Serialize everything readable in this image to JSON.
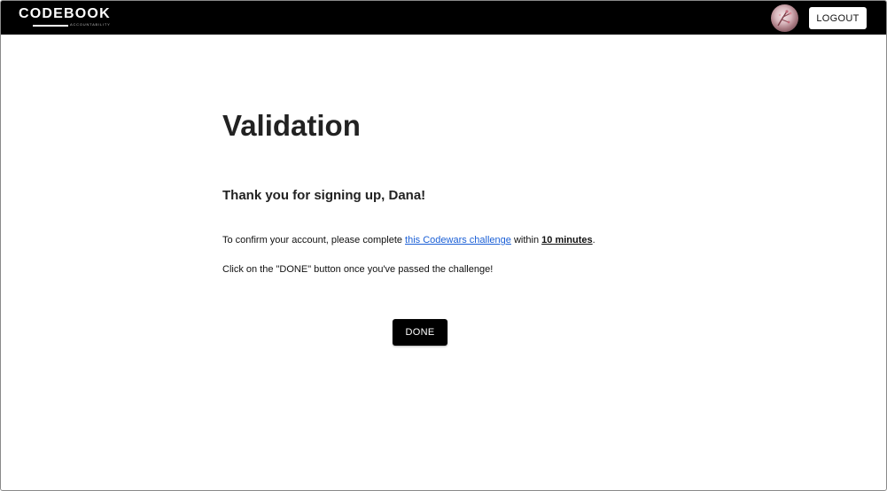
{
  "header": {
    "brand": "CODEBOOK",
    "brand_tagline": "ACCOUNTABILITY",
    "logout_label": "LOGOUT",
    "avatar_icon": "user-avatar-icon"
  },
  "main": {
    "title": "Validation",
    "greeting": "Thank you for signing up, Dana!",
    "instruction_prefix": "To confirm your account, please complete ",
    "challenge_link": "this Codewars challenge",
    "instruction_middle": " within ",
    "time_limit": "10 minutes",
    "instruction_suffix": ".",
    "note": "Click on the \"DONE\" button once you've passed the challenge!",
    "done_label": "DONE"
  },
  "colors": {
    "header_bg": "#000000",
    "link": "#1a5fd6",
    "button_bg": "#000000",
    "button_text": "#ffffff"
  }
}
